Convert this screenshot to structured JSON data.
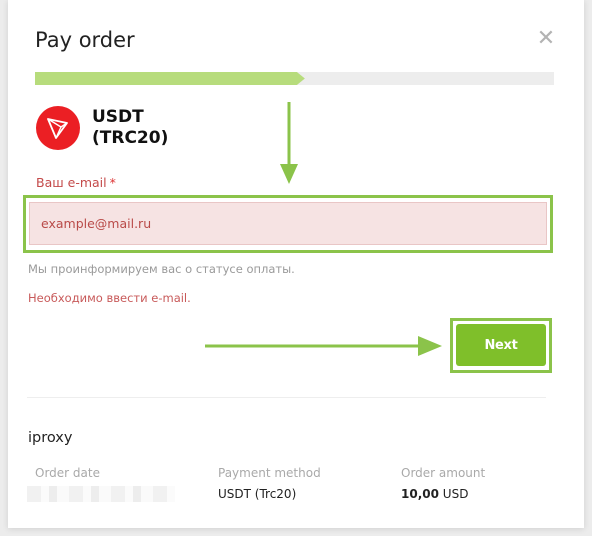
{
  "dialog": {
    "title": "Pay order",
    "close_glyph": "✕",
    "progress_percent": 52
  },
  "coin": {
    "line1": "USDT",
    "line2": "(TRC20)",
    "logo_icon": "tron-logo-icon",
    "logo_color": "#eb1f24"
  },
  "email": {
    "label": "Ваш e-mail",
    "required_mark": "*",
    "placeholder": "example@mail.ru",
    "value": "",
    "hint": "Мы проинформируем вас о статусе оплаты.",
    "error": "Необходимо ввести e-mail."
  },
  "actions": {
    "next_label": "Next",
    "accent_color": "#7fbf2a"
  },
  "order": {
    "merchant": "iproxy",
    "date_label": "Order date",
    "method_label": "Payment method",
    "method_value": "USDT (Trc20)",
    "amount_label": "Order amount",
    "amount_number": "10,00",
    "amount_currency": "USD"
  },
  "annotation_color": "#8bc34a"
}
